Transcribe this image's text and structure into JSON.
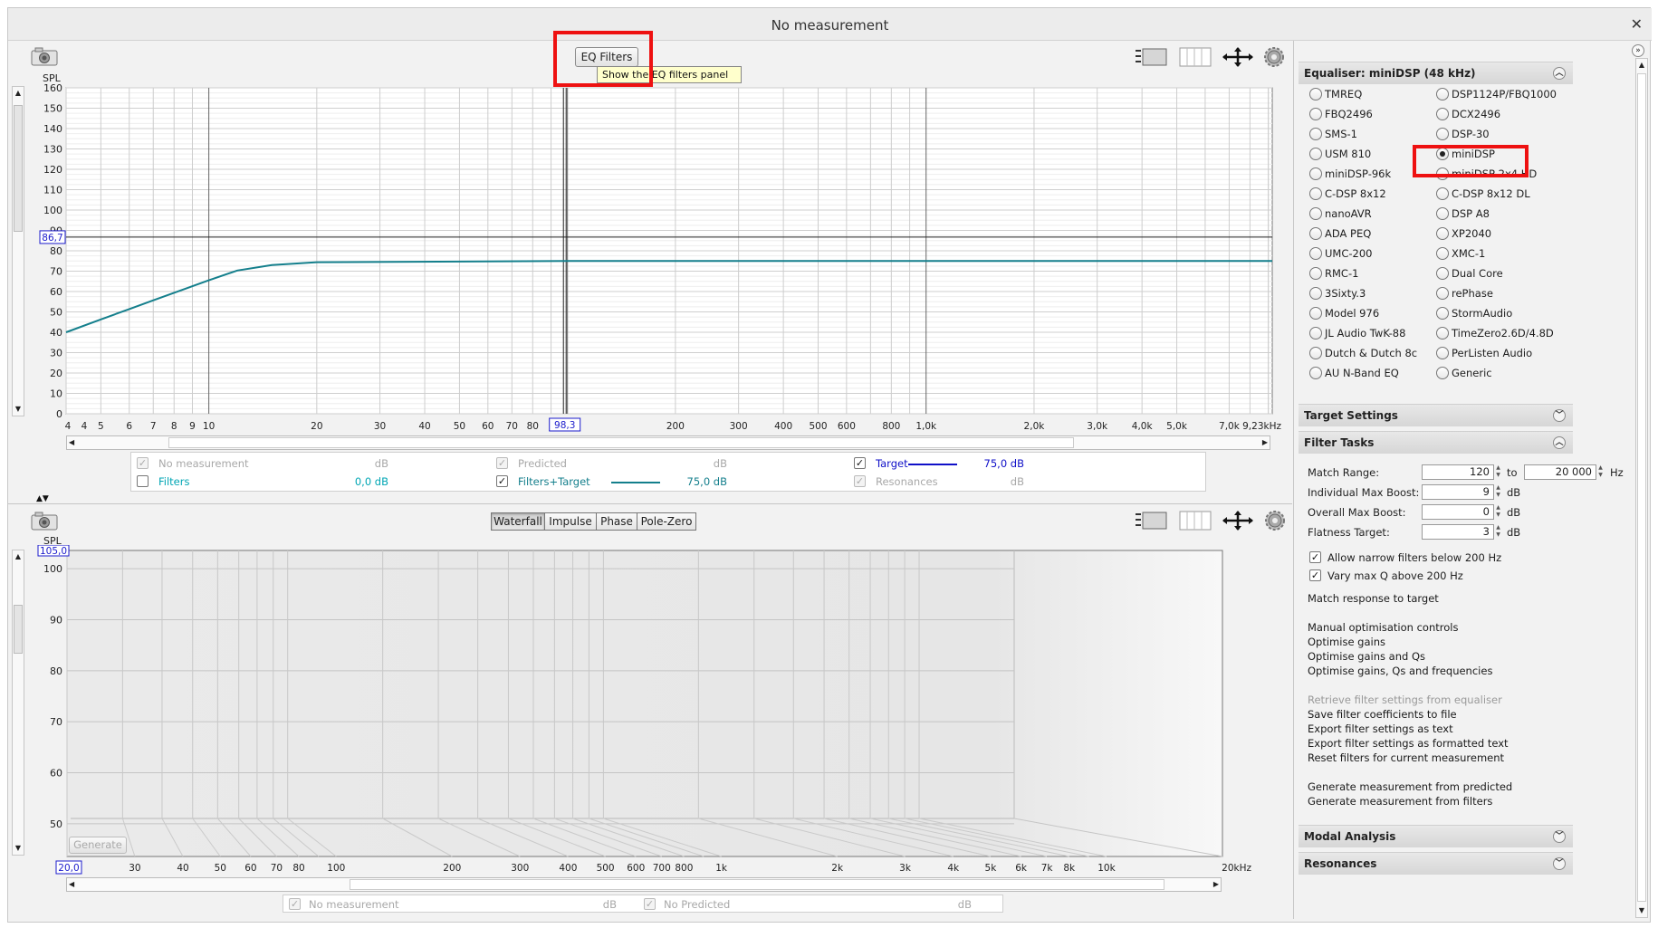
{
  "window": {
    "title": "No measurement",
    "close_glyph": "✕"
  },
  "top": {
    "eq_button": "EQ Filters",
    "tooltip": "Show the EQ filters panel",
    "y_axis_label": "SPL",
    "cursor_y": "86,7",
    "cursor_x": "98,3",
    "y_ticks": [
      "160",
      "150",
      "140",
      "130",
      "120",
      "110",
      "100",
      "90",
      "80",
      "70",
      "60",
      "50",
      "40",
      "30",
      "20",
      "10",
      "0"
    ],
    "x_ticks": [
      "4",
      "4",
      "5",
      "6",
      "7",
      "8",
      "9",
      "10",
      "20",
      "30",
      "40",
      "50",
      "60",
      "70",
      "80",
      "200",
      "300",
      "400",
      "500",
      "600",
      "800",
      "1,0k",
      "2,0k",
      "3,0k",
      "4,0k",
      "5,0k",
      "7,0k",
      "9,23kHz"
    ],
    "legend": [
      {
        "label": "No measurement",
        "value": "dB",
        "checked": true,
        "disabled": true
      },
      {
        "label": "Predicted",
        "value": "dB",
        "checked": true,
        "disabled": true
      },
      {
        "label": "Target",
        "value": "75,0 dB",
        "checked": true,
        "disabled": false,
        "color": "#1010c8"
      },
      {
        "label": "Filters",
        "value": "0,0 dB",
        "checked": false,
        "disabled": false,
        "color": "#00a6b4"
      },
      {
        "label": "Filters+Target",
        "value": "75,0 dB",
        "checked": true,
        "disabled": false,
        "color": "#147f8c"
      },
      {
        "label": "Resonances",
        "value": "dB",
        "checked": true,
        "disabled": true
      }
    ]
  },
  "chart_data": [
    {
      "type": "line",
      "title": "",
      "xlabel": "",
      "ylabel": "SPL",
      "x_scale": "log",
      "ylim": [
        0,
        160
      ],
      "grid": true,
      "series": [
        {
          "name": "Filters+Target",
          "x": [
            4,
            5,
            6,
            7,
            8,
            10,
            12,
            15,
            20,
            100,
            1000,
            9230
          ],
          "y": [
            40,
            46.3,
            51.4,
            55.7,
            59.4,
            65.5,
            70.3,
            73.0,
            74.4,
            75,
            75,
            75
          ],
          "color": "#147f8c"
        }
      ]
    },
    {
      "type": "line",
      "title": "",
      "xlabel": "",
      "ylabel": "SPL",
      "x_scale": "log",
      "ylim": [
        45,
        105
      ],
      "grid": true,
      "series": []
    }
  ],
  "bottom": {
    "tabs": [
      "Waterfall",
      "Impulse",
      "Phase",
      "Pole-Zero"
    ],
    "selected_tab": "Waterfall",
    "y_axis_label": "SPL",
    "cursor_y": "105,0",
    "cursor_x": "20,0",
    "y_ticks": [
      "100",
      "90",
      "80",
      "70",
      "60",
      "50"
    ],
    "x_ticks": [
      "30",
      "40",
      "50",
      "60",
      "70",
      "80",
      "100",
      "200",
      "300",
      "400",
      "500",
      "600",
      "700",
      "800",
      "1k",
      "2k",
      "3k",
      "4k",
      "5k",
      "6k",
      "7k",
      "8k",
      "10k",
      "20kHz"
    ],
    "generate_button": "Generate",
    "legend": [
      {
        "label": "No measurement",
        "value": "dB",
        "checked": true,
        "disabled": true
      },
      {
        "label": "No Predicted",
        "value": "dB",
        "checked": true,
        "disabled": true
      }
    ]
  },
  "right": {
    "equaliser_header": "Equaliser: miniDSP (48 kHz)",
    "equalisers_left": [
      "TMREQ",
      "FBQ2496",
      "SMS-1",
      "USM 810",
      "miniDSP-96k",
      "C-DSP 8x12",
      "nanoAVR",
      "ADA PEQ",
      "UMC-200",
      "RMC-1",
      "3Sixty.3",
      "Model 976",
      "JL Audio TwK-88",
      "Dutch & Dutch 8c",
      "AU N-Band EQ"
    ],
    "equalisers_right": [
      "DSP1124P/FBQ1000",
      "DCX2496",
      "DSP-30",
      "miniDSP",
      "miniDSP 2x4 HD",
      "C-DSP 8x12 DL",
      "DSP A8",
      "XP2040",
      "XMC-1",
      "Dual Core",
      "rePhase",
      "StormAudio",
      "TimeZero2.6D/4.8D",
      "PerListen Audio",
      "Generic"
    ],
    "selected": "miniDSP",
    "target_settings": "Target Settings",
    "filter_tasks": "Filter Tasks",
    "match_range_label": "Match Range:",
    "match_from": "120",
    "to_label": "to",
    "match_to": "20 000",
    "hz": "Hz",
    "indiv_boost_label": "Individual Max Boost:",
    "indiv_boost": "9",
    "overall_boost_label": "Overall Max Boost:",
    "overall_boost": "0",
    "flatness_label": "Flatness Target:",
    "flatness": "3",
    "db": "dB",
    "allow_narrow": "Allow narrow filters below 200 Hz",
    "vary_q": "Vary max Q above 200 Hz",
    "match_response": "Match response to target",
    "manual_controls": "Manual optimisation controls",
    "opt1": "Optimise gains",
    "opt2": "Optimise gains and Qs",
    "opt3": "Optimise gains, Qs and frequencies",
    "retrieve": "Retrieve filter settings from equaliser",
    "save_coeff": "Save filter coefficients to file",
    "export_text": "Export filter settings as text",
    "export_formatted": "Export filter settings as formatted text",
    "reset": "Reset filters for current measurement",
    "gen_pred": "Generate measurement from predicted",
    "gen_filters": "Generate measurement from filters",
    "modal": "Modal Analysis",
    "resonances": "Resonances"
  }
}
